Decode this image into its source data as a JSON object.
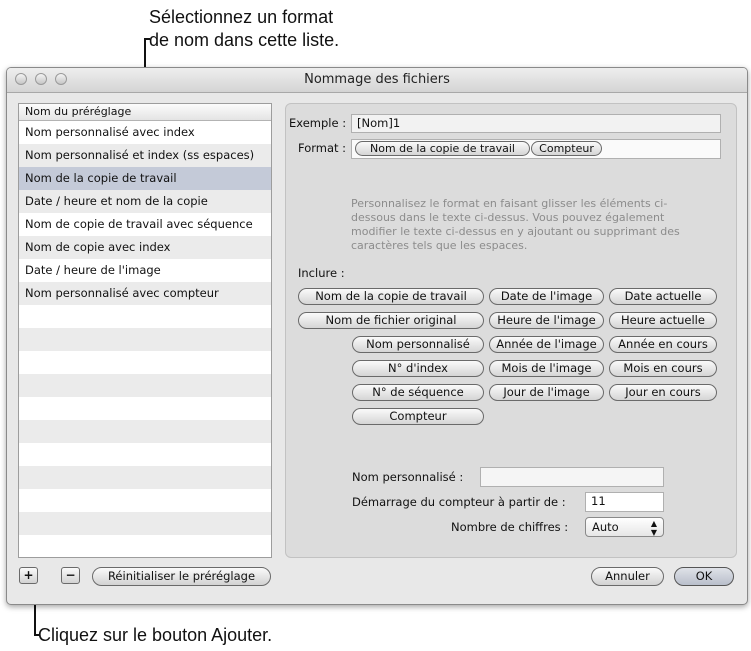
{
  "annotations": {
    "top_line1": "Sélectionnez un format",
    "top_line2": "de nom dans cette liste.",
    "bottom": "Cliquez sur le bouton Ajouter."
  },
  "window": {
    "title": "Nommage des fichiers"
  },
  "presets": {
    "header": "Nom du préréglage",
    "items": [
      "Nom personnalisé avec index",
      "Nom personnalisé et index (ss espaces)",
      "Nom de la copie de travail",
      "Date / heure et nom de la copie",
      "Nom de copie de travail avec séquence",
      "Nom de copie avec index",
      "Date / heure de l'image",
      "Nom personnalisé avec compteur"
    ],
    "selected_index": 2
  },
  "example": {
    "label": "Exemple :",
    "value": "[Nom]1"
  },
  "format": {
    "label": "Format :",
    "tokens": [
      "Nom de la copie de travail",
      "Compteur"
    ],
    "hint": "Personnalisez le format en faisant glisser les éléments ci-dessous dans le texte ci-dessus. Vous pouvez également modifier le texte ci-dessus en y ajoutant ou supprimant des caractères tels que les espaces."
  },
  "include": {
    "label": "Inclure :",
    "tokens": [
      "Nom de la copie de travail",
      "Date de l'image",
      "Date actuelle",
      "Nom de fichier original",
      "Heure de l'image",
      "Heure actuelle",
      "Nom personnalisé",
      "Année de l'image",
      "Année en cours",
      "N° d'index",
      "Mois de l'image",
      "Mois en cours",
      "N° de séquence",
      "Jour de l'image",
      "Jour en cours",
      "Compteur"
    ]
  },
  "custom_name": {
    "label": "Nom personnalisé :",
    "value": ""
  },
  "counter_start": {
    "label": "Démarrage du compteur à partir de :",
    "value": "11"
  },
  "digits": {
    "label": "Nombre de chiffres :",
    "value": "Auto"
  },
  "buttons": {
    "add": "+",
    "remove": "−",
    "reset": "Réinitialiser le préréglage",
    "cancel": "Annuler",
    "ok": "OK"
  }
}
